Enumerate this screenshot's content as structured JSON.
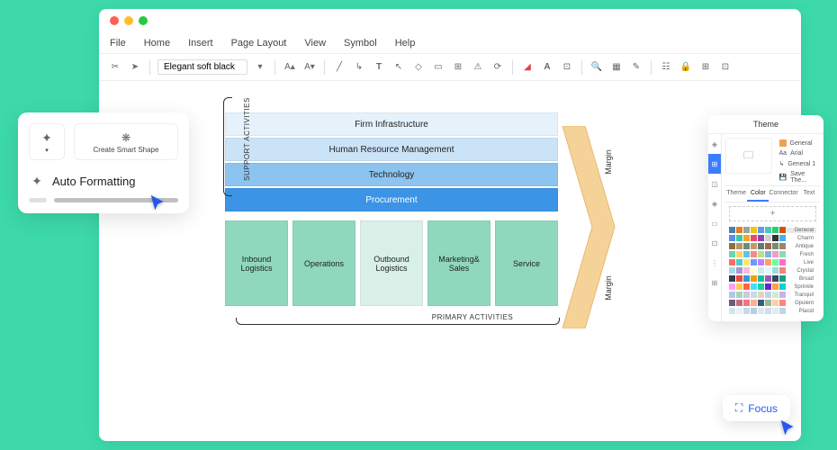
{
  "menu": {
    "items": [
      "File",
      "Home",
      "Insert",
      "Page Layout",
      "View",
      "Symbol",
      "Help"
    ]
  },
  "toolbar": {
    "font": "Elegant soft black"
  },
  "diagram": {
    "support_label": "SUPPORT ACTIVITIES",
    "primary_label": "PRIMARY ACTIVITIES",
    "support": [
      "Firm Infrastructure",
      "Human Resource Management",
      "Technology",
      "Procurement"
    ],
    "primary": [
      "Inbound Logistics",
      "Operations",
      "Outbound Logistics",
      "Marketing& Sales",
      "Service"
    ],
    "margin": "Margin"
  },
  "popup_auto": {
    "create_smart": "Create Smart Shape",
    "main": "Auto Formatting"
  },
  "panel": {
    "title": "Theme",
    "styles": [
      "General",
      "Arial",
      "General 1",
      "Save The..."
    ],
    "tabs": [
      "Theme",
      "Color",
      "Connector",
      "Text"
    ],
    "swatch_names": [
      "General",
      "Charm",
      "Antique",
      "Fresh",
      "Live",
      "Crystal",
      "Broad",
      "Sprinkle",
      "Tranquil",
      "Opulent",
      "Placid"
    ],
    "colors": {
      "General": [
        "#4a7fb5",
        "#e67e22",
        "#95a5a6",
        "#f1c40f",
        "#5d9cec",
        "#48c9b0",
        "#2ecc71",
        "#d35400"
      ],
      "Charm": [
        "#5b8def",
        "#3bc9a3",
        "#f5a623",
        "#e94b6e",
        "#8e44ad",
        "#d0d0d0",
        "#333333",
        "#48b0e8"
      ],
      "Antique": [
        "#8b6f47",
        "#b8956a",
        "#6b8e7f",
        "#c49a6c",
        "#5d7b6f",
        "#9c6b4e",
        "#7a8b6f",
        "#a0826d"
      ],
      "Fresh": [
        "#6dd5a8",
        "#f9d56e",
        "#5ec8d8",
        "#f08c8c",
        "#b5e08c",
        "#7fb6d6",
        "#e8a0c8",
        "#8cd9b3"
      ],
      "Live": [
        "#ff6b6b",
        "#4ecdc4",
        "#ffe66d",
        "#6b9bff",
        "#c77dff",
        "#ff9f6b",
        "#6bff9f",
        "#ff6bc7"
      ],
      "Crystal": [
        "#a8d8ea",
        "#aa96da",
        "#fcbad3",
        "#ffffd2",
        "#c7ecee",
        "#dff9fb",
        "#95e1d3",
        "#f38181"
      ],
      "Broad": [
        "#2c3e50",
        "#e74c3c",
        "#3498db",
        "#f39c12",
        "#1abc9c",
        "#9b59b6",
        "#34495e",
        "#16a085"
      ],
      "Sprinkle": [
        "#ff9ff3",
        "#feca57",
        "#ff6348",
        "#48dbfb",
        "#1dd1a1",
        "#5f27cd",
        "#ff9f43",
        "#00d2d3"
      ],
      "Tranquil": [
        "#b4c7e7",
        "#a8d5ba",
        "#d4c5e2",
        "#c5dde8",
        "#e2d4c5",
        "#bcd4e6",
        "#d5e8d4",
        "#c7b4e7"
      ],
      "Opulent": [
        "#6c5b7b",
        "#c06c84",
        "#f67280",
        "#f8b195",
        "#355c7d",
        "#99b898",
        "#fecea8",
        "#ff847c"
      ],
      "Placid": [
        "#d6e4f0",
        "#e8eff5",
        "#c8d9e8",
        "#b8cfe0",
        "#dce9f2",
        "#cfe0ec",
        "#e0ebf4",
        "#c0d4e4"
      ]
    }
  },
  "focus": {
    "label": "Focus"
  }
}
